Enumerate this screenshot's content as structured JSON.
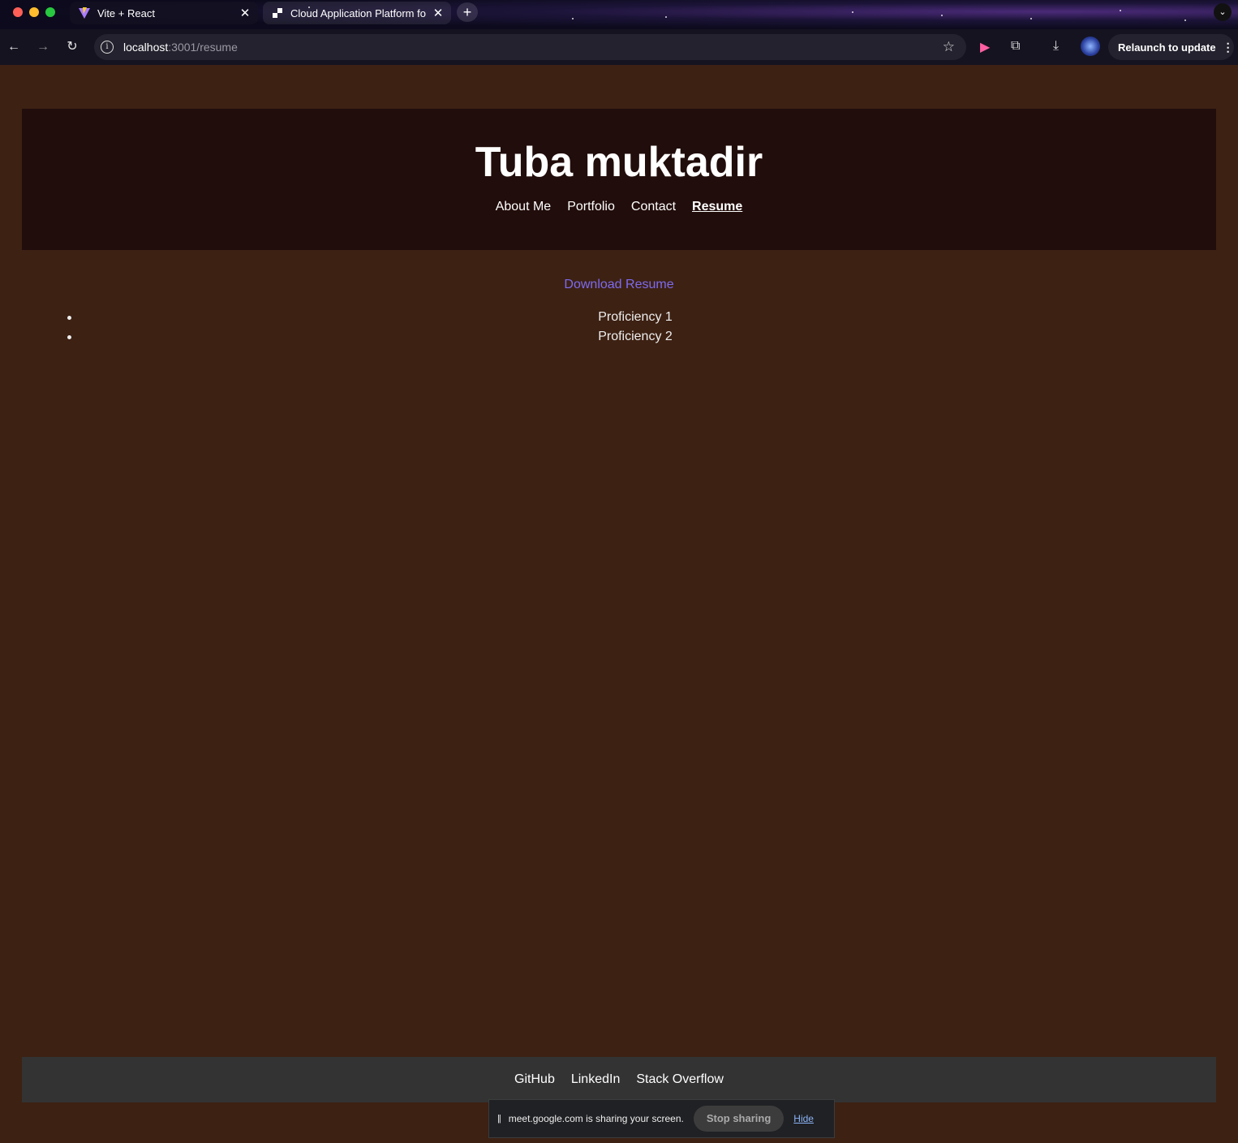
{
  "browser": {
    "tabs": [
      {
        "title": "Vite + React",
        "favicon": "vite-icon"
      },
      {
        "title": "Cloud Application Platform fo",
        "favicon": "cloud-platform-icon"
      }
    ],
    "new_tab": "+",
    "url_host": "localhost",
    "url_path": ":3001/resume",
    "relaunch_label": "Relaunch to update"
  },
  "site": {
    "title": "Tuba muktadir",
    "nav": [
      "About Me",
      "Portfolio",
      "Contact",
      "Resume"
    ],
    "active_nav": "Resume",
    "download_label": "Download Resume",
    "proficiencies": [
      "Proficiency 1",
      "Proficiency 2"
    ],
    "footer_links": [
      "GitHub",
      "LinkedIn",
      "Stack Overflow"
    ]
  },
  "share_bar": {
    "message": "meet.google.com is sharing your screen.",
    "stop_label": "Stop sharing",
    "hide_label": "Hide"
  },
  "colors": {
    "page_bg": "#3d2113",
    "header_bg": "#210d0b",
    "footer_bg": "#333333",
    "link_accent": "#7d6bf0"
  }
}
